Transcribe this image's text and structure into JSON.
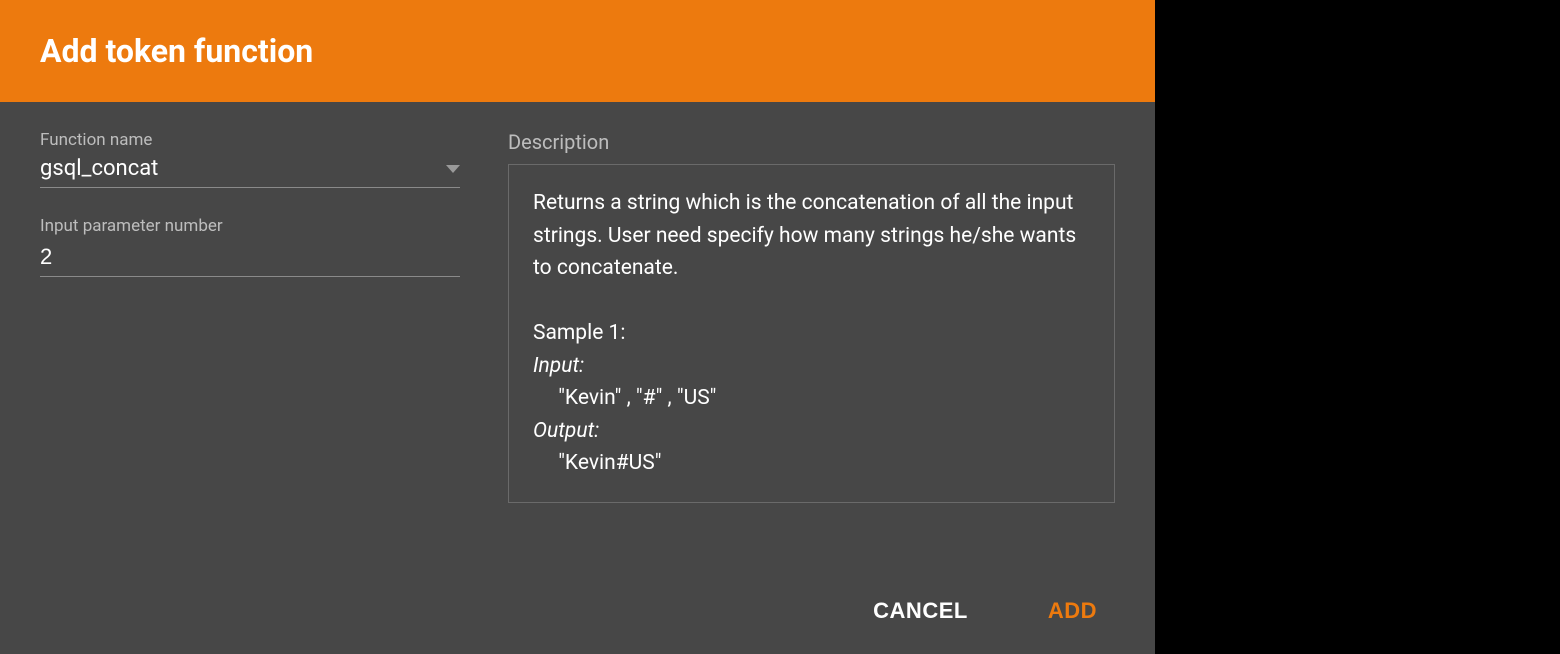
{
  "header": {
    "title": "Add token function"
  },
  "fields": {
    "function_name_label": "Function name",
    "function_name_value": "gsql_concat",
    "input_param_label": "Input parameter number",
    "input_param_value": "2",
    "description_label": "Description",
    "desc_p1": "Returns a string which is the concatenation of all the input strings. User need specify how many strings he/she wants to concatenate.",
    "desc_sample": "Sample 1:",
    "desc_input_label": "Input:",
    "desc_input_value": "\"Kevin\" ,    \"#\" ,    \"US\"",
    "desc_output_label": "Output:",
    "desc_output_value": "\"Kevin#US\""
  },
  "footer": {
    "cancel": "CANCEL",
    "add": "ADD"
  }
}
